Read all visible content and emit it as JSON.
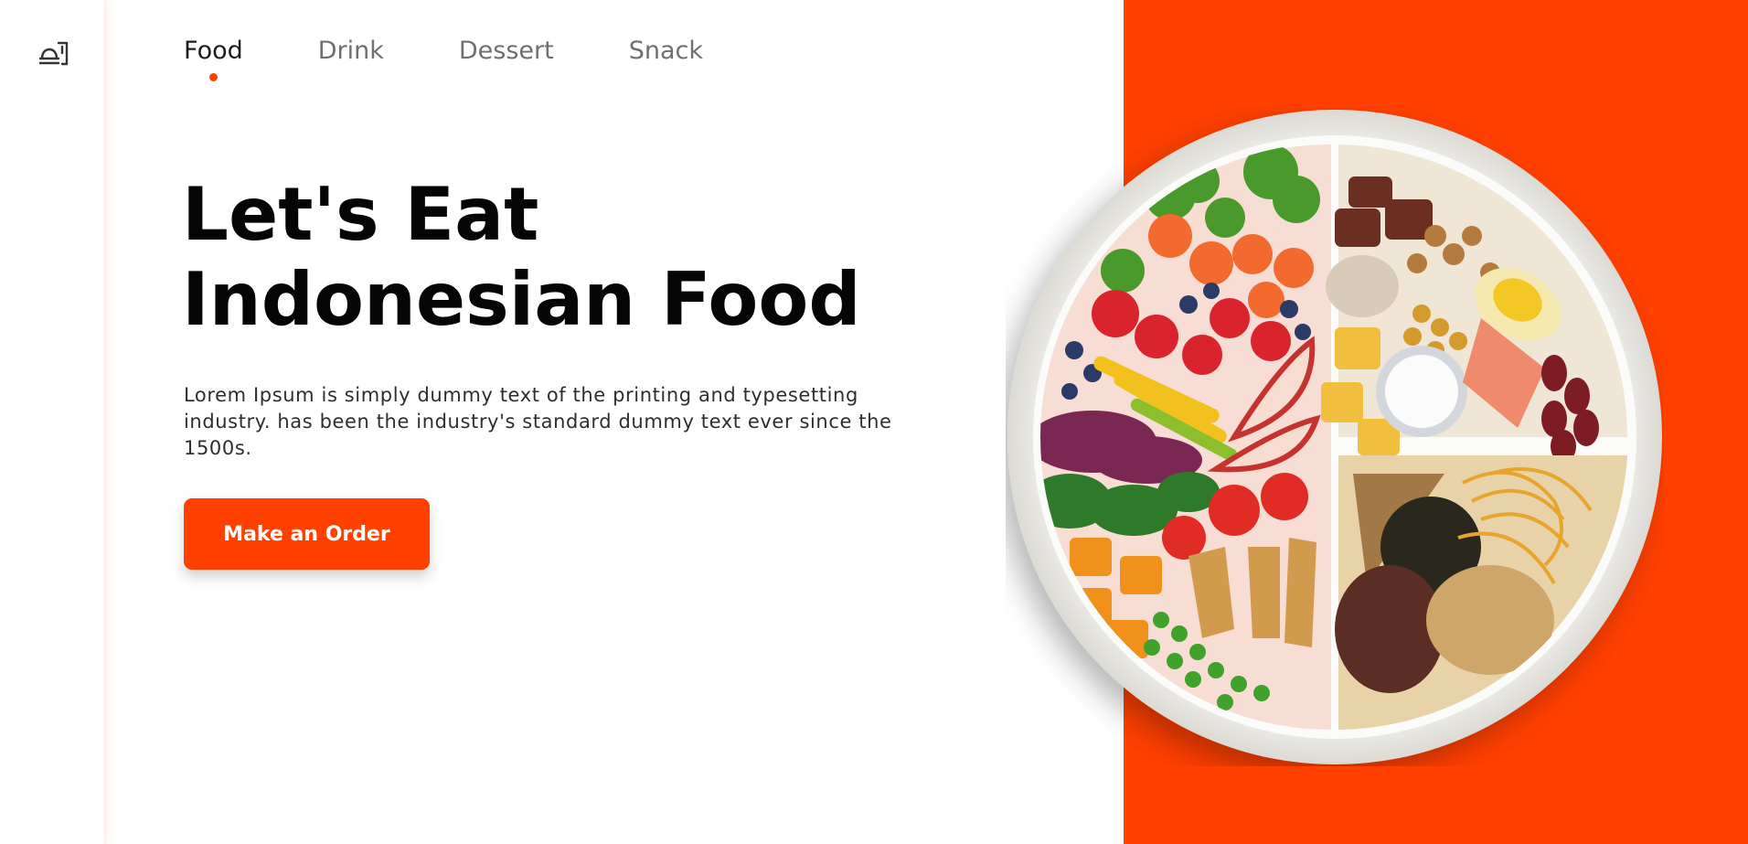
{
  "nav": {
    "items": [
      {
        "label": "Food",
        "active": true
      },
      {
        "label": "Drink",
        "active": false
      },
      {
        "label": "Dessert",
        "active": false
      },
      {
        "label": "Snack",
        "active": false
      }
    ]
  },
  "hero": {
    "title_line1": "Let's Eat",
    "title_line2": "Indonesian Food",
    "description": "Lorem Ipsum is simply dummy text of the printing and typesetting industry. has been the industry's standard dummy text ever since the 1500s.",
    "cta_label": "Make an Order"
  },
  "icons": {
    "logo": "food-tray-icon",
    "plate": "food-plate-image"
  },
  "colors": {
    "accent": "#ff4000",
    "text_dark": "#050505",
    "nav_inactive": "#6f6f6f"
  }
}
